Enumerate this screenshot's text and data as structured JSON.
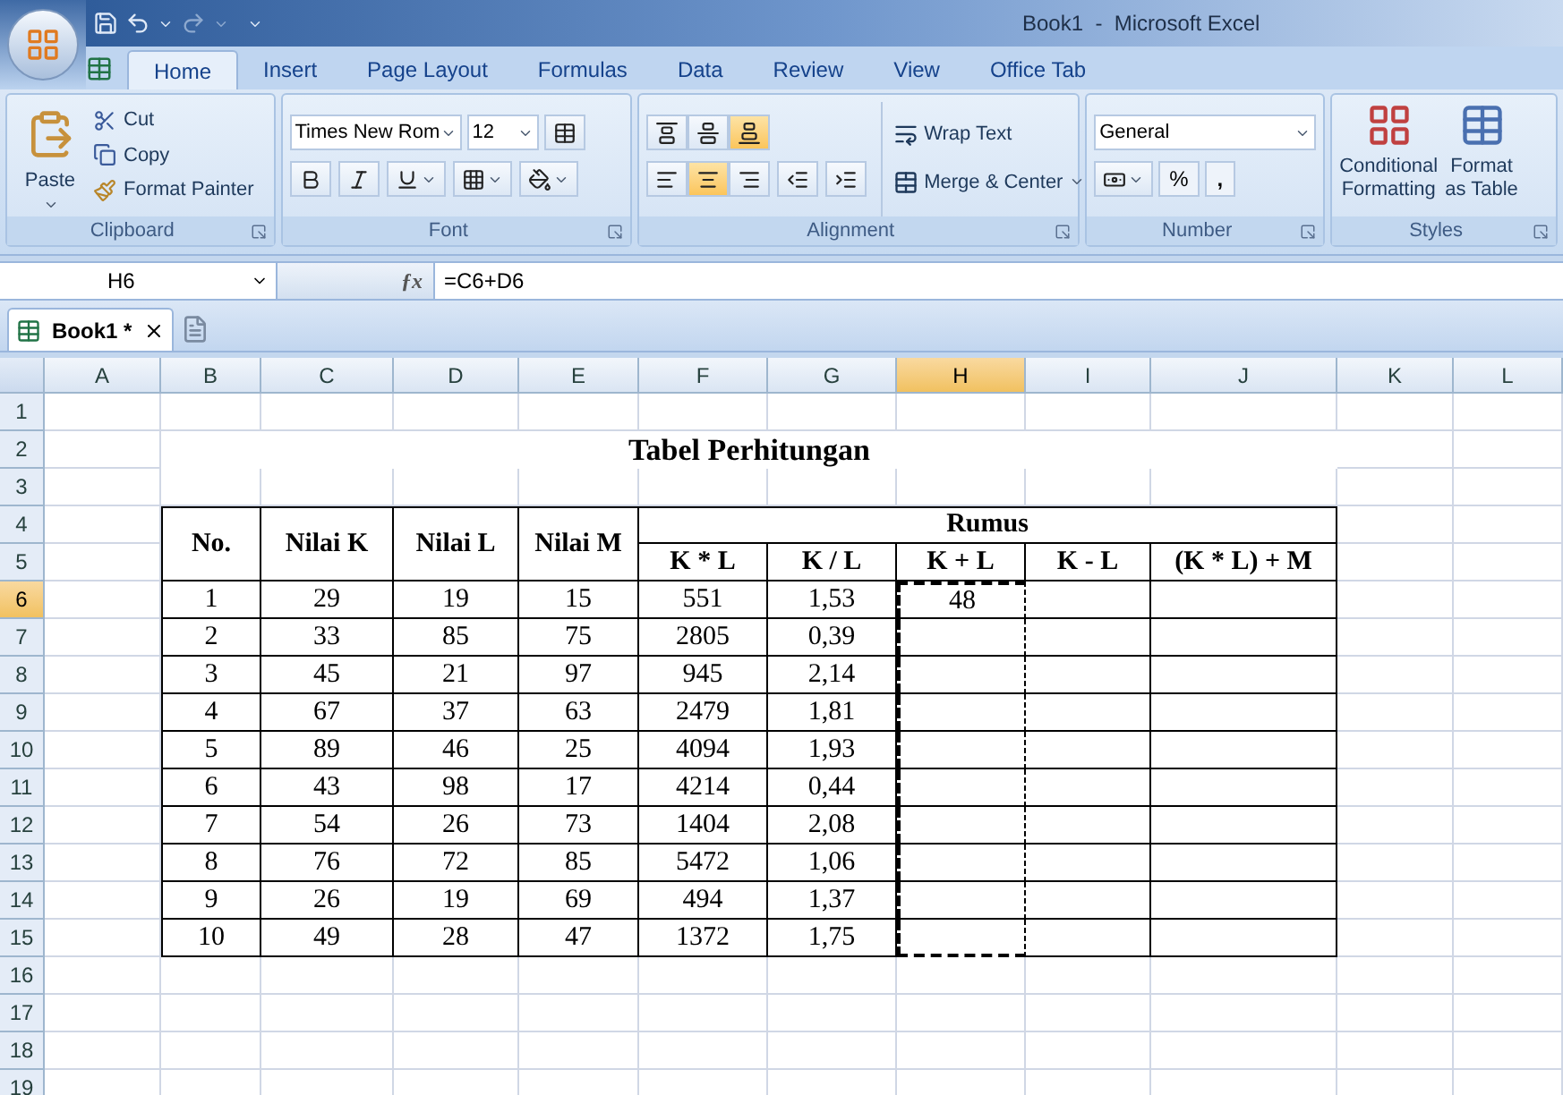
{
  "window": {
    "title": "Book1  -  Microsoft Excel"
  },
  "ribbon_tabs": [
    {
      "label": "Home",
      "selected": true
    },
    {
      "label": "Insert",
      "selected": false
    },
    {
      "label": "Page Layout",
      "selected": false
    },
    {
      "label": "Formulas",
      "selected": false
    },
    {
      "label": "Data",
      "selected": false
    },
    {
      "label": "Review",
      "selected": false
    },
    {
      "label": "View",
      "selected": false
    },
    {
      "label": "Office Tab",
      "selected": false
    }
  ],
  "clipboard": {
    "label": "Clipboard",
    "paste": "Paste",
    "cut": "Cut",
    "copy": "Copy",
    "format_painter": "Format Painter"
  },
  "font": {
    "label": "Font",
    "name": "Times New Rom",
    "size": "12"
  },
  "alignment": {
    "label": "Alignment",
    "vertical": [
      {
        "kind": "top",
        "selected": false
      },
      {
        "kind": "middle",
        "selected": false
      },
      {
        "kind": "bottom",
        "selected": true
      }
    ],
    "horizontal": [
      {
        "kind": "left",
        "selected": false
      },
      {
        "kind": "center",
        "selected": true
      },
      {
        "kind": "right",
        "selected": false
      }
    ],
    "wrap_text": "Wrap Text",
    "merge_center": "Merge & Center"
  },
  "number": {
    "label": "Number",
    "format": "General",
    "percent": "%",
    "comma": ","
  },
  "styles": {
    "label": "Styles",
    "conditional": [
      "Conditional",
      "Formatting"
    ],
    "format_table": [
      "Format",
      "as Table"
    ]
  },
  "formula_bar": {
    "name_box": "H6",
    "fx": "ƒx",
    "formula": "=C6+D6"
  },
  "doc_tabs": [
    {
      "label": "Book1 *",
      "selected": true
    }
  ],
  "columns": [
    {
      "label": "A",
      "selected": false
    },
    {
      "label": "B",
      "selected": false
    },
    {
      "label": "C",
      "selected": false
    },
    {
      "label": "D",
      "selected": false
    },
    {
      "label": "E",
      "selected": false
    },
    {
      "label": "F",
      "selected": false
    },
    {
      "label": "G",
      "selected": false
    },
    {
      "label": "H",
      "selected": true
    },
    {
      "label": "I",
      "selected": false
    },
    {
      "label": "J",
      "selected": false
    },
    {
      "label": "K",
      "selected": false
    },
    {
      "label": "L",
      "selected": false
    }
  ],
  "rows": [
    {
      "label": "1",
      "selected": false
    },
    {
      "label": "2",
      "selected": false
    },
    {
      "label": "3",
      "selected": false
    },
    {
      "label": "4",
      "selected": false
    },
    {
      "label": "5",
      "selected": false
    },
    {
      "label": "6",
      "selected": true
    },
    {
      "label": "7",
      "selected": false
    },
    {
      "label": "8",
      "selected": false
    },
    {
      "label": "9",
      "selected": false
    },
    {
      "label": "10",
      "selected": false
    },
    {
      "label": "11",
      "selected": false
    },
    {
      "label": "12",
      "selected": false
    },
    {
      "label": "13",
      "selected": false
    },
    {
      "label": "14",
      "selected": false
    },
    {
      "label": "15",
      "selected": false
    },
    {
      "label": "16",
      "selected": false
    },
    {
      "label": "17",
      "selected": false
    },
    {
      "label": "18",
      "selected": false
    },
    {
      "label": "19",
      "selected": false
    }
  ],
  "sheet": {
    "title": "Tabel Perhitungan",
    "headers": [
      "No.",
      "Nilai K",
      "Nilai L",
      "Nilai M"
    ],
    "group_header": "Rumus",
    "formula_headers": [
      "K * L",
      "K / L",
      "K + L",
      "K - L",
      "(K * L) + M"
    ],
    "data": [
      {
        "cells": [
          "1",
          "29",
          "19",
          "15",
          "551",
          "1,53",
          "48"
        ],
        "marked": true
      },
      {
        "cells": [
          "2",
          "33",
          "85",
          "75",
          "2805",
          "0,39"
        ],
        "marked": true
      },
      {
        "cells": [
          "3",
          "45",
          "21",
          "97",
          "945",
          "2,14"
        ],
        "marked": true
      },
      {
        "cells": [
          "4",
          "67",
          "37",
          "63",
          "2479",
          "1,81"
        ],
        "marked": true
      },
      {
        "cells": [
          "5",
          "89",
          "46",
          "25",
          "4094",
          "1,93"
        ],
        "marked": true
      },
      {
        "cells": [
          "6",
          "43",
          "98",
          "17",
          "4214",
          "0,44"
        ],
        "marked": true
      },
      {
        "cells": [
          "7",
          "54",
          "26",
          "73",
          "1404",
          "2,08"
        ],
        "marked": true
      },
      {
        "cells": [
          "8",
          "76",
          "72",
          "85",
          "5472",
          "1,06"
        ],
        "marked": true
      },
      {
        "cells": [
          "9",
          "26",
          "19",
          "69",
          "494",
          "1,37"
        ],
        "marked": true
      },
      {
        "cells": [
          "10",
          "49",
          "28",
          "47",
          "1372",
          "1,75"
        ],
        "marked": true
      }
    ]
  }
}
